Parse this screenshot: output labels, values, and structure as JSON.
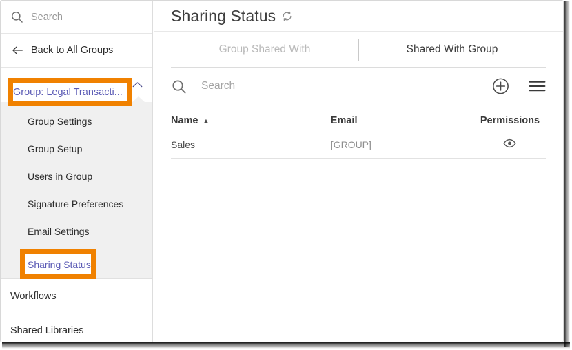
{
  "sidebar": {
    "search": {
      "placeholder": "Search",
      "icon": "search-icon"
    },
    "back": {
      "label": "Back to All Groups",
      "icon": "arrow-left-icon"
    },
    "group_header": {
      "label": "Group: Legal Transacti...",
      "chevron": "chevron-up-icon"
    },
    "submenu_items": [
      {
        "label": "Group Settings",
        "selected": false
      },
      {
        "label": "Group Setup",
        "selected": false
      },
      {
        "label": "Users in Group",
        "selected": false
      },
      {
        "label": "Signature Preferences",
        "selected": false
      },
      {
        "label": "Email Settings",
        "selected": false
      },
      {
        "label": "Sharing Status",
        "selected": true
      }
    ],
    "footer_items": [
      {
        "label": "Workflows"
      },
      {
        "label": "Shared Libraries"
      }
    ]
  },
  "main": {
    "title": "Sharing Status",
    "refresh_icon": "refresh-icon",
    "tabs": [
      {
        "label": "Group Shared With",
        "active": false
      },
      {
        "label": "Shared With Group",
        "active": true
      }
    ],
    "search": {
      "placeholder": "Search",
      "value": "",
      "icon": "search-icon"
    },
    "actions": [
      {
        "name": "add-icon",
        "label": "+"
      },
      {
        "name": "menu-icon",
        "label": "☰"
      }
    ],
    "table": {
      "columns": [
        "Name",
        "Email",
        "Permissions"
      ],
      "sort_column": "Name",
      "sort_direction": "▲",
      "rows": [
        {
          "name": "Sales",
          "email": "[GROUP]",
          "permission_icon": "eye-icon"
        }
      ]
    }
  },
  "annotations": {
    "highlight_color": "#f08100",
    "boxes": [
      {
        "name": "group-header-highlight",
        "target": "Group: Legal Transacti..."
      },
      {
        "name": "sharing-status-highlight",
        "target": "Sharing Status"
      }
    ]
  }
}
